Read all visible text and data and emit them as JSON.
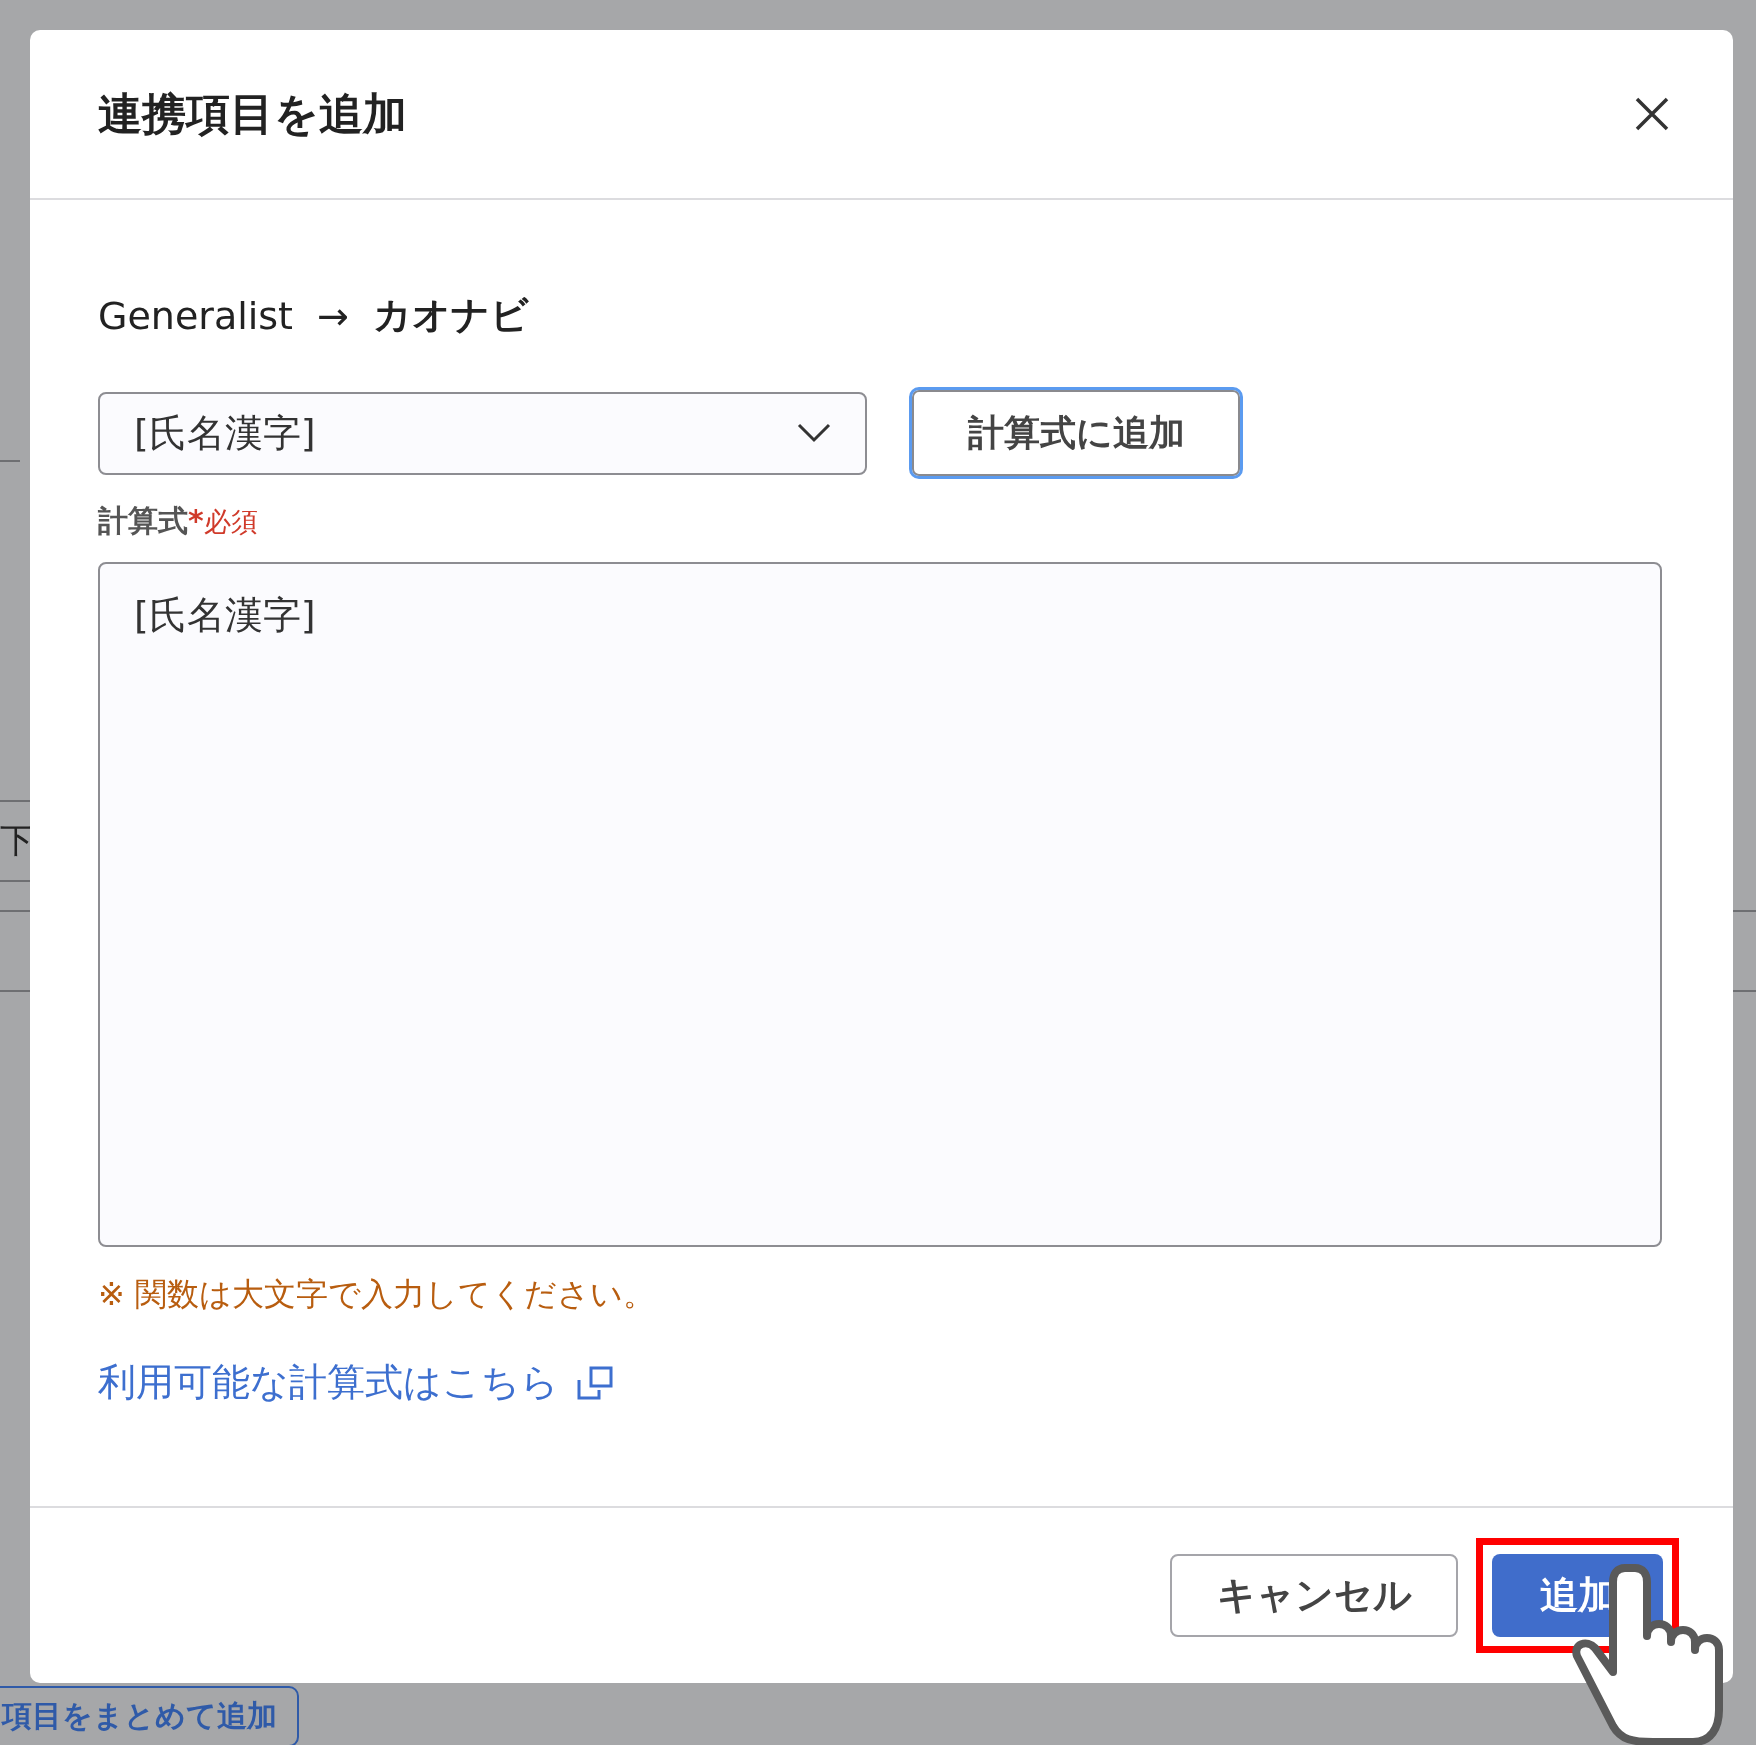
{
  "background": {
    "side_text": "下",
    "bottom_button": "項目をまとめて追加"
  },
  "dialog": {
    "title": "連携項目を追加",
    "source": "Generalist",
    "arrow": "→",
    "target": "カオナビ",
    "field_select": {
      "value": "[氏名漢字]"
    },
    "add_to_formula_button": "計算式に追加",
    "formula": {
      "label": "計算式",
      "required_mark": "*",
      "required_text": "必須",
      "value": "[氏名漢字]"
    },
    "note": "※ 関数は大文字で入力してください。",
    "link": "利用可能な計算式はこちら",
    "buttons": [
      {
        "label": "キャンセル",
        "kind": "secondary",
        "highlighted": false
      },
      {
        "label": "追加",
        "kind": "primary",
        "highlighted": true
      }
    ]
  }
}
